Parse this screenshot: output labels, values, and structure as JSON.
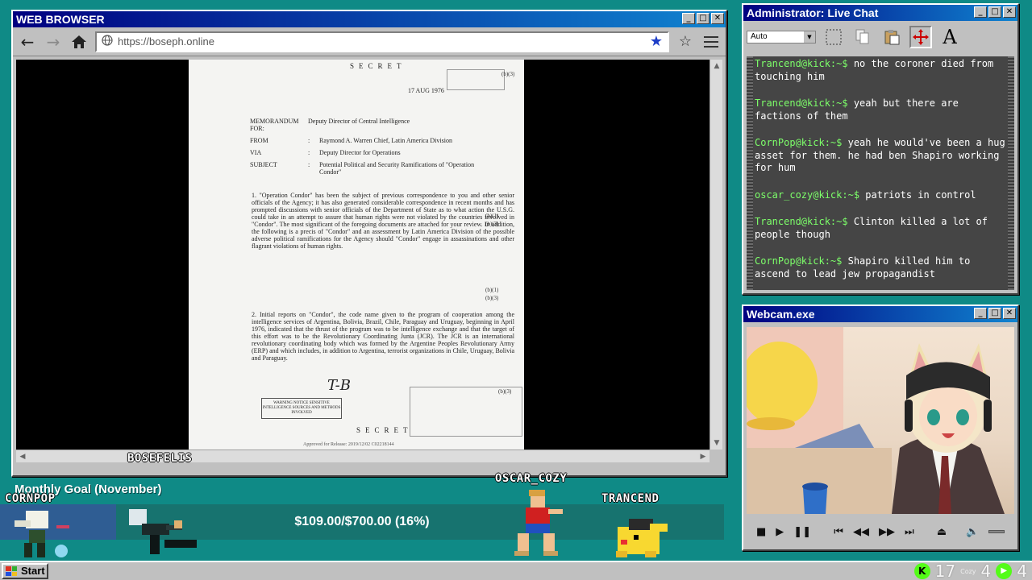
{
  "browser": {
    "title": "WEB BROWSER",
    "url": "https://boseph.online",
    "document": {
      "classification": "SECRET",
      "date": "17 AUG 1976",
      "exemption": "(b)(3)",
      "exemption_1": "(b)(1)",
      "header": [
        {
          "key": "MEMORANDUM FOR:",
          "value": "Deputy Director of Central Intelligence"
        },
        {
          "key": "FROM",
          "value": "Raymond A. Warren Chief, Latin America Division"
        },
        {
          "key": "VIA",
          "value": "Deputy Director for Operations"
        },
        {
          "key": "SUBJECT",
          "value": "Potential Political and Security Ramifications of \"Operation Condor\""
        }
      ],
      "para1": "1. \"Operation Condor\" has been the subject of previous correspondence to you and other senior officials of the Agency; it has also generated considerable correspondence in recent months and has prompted discussions with senior officials of the Department of State as to what action the U.S.G. could take in an attempt to assure that human rights were not violated by the countries involved in \"Condor\". The most significant of the foregoing documents are attached for your review. In addition, the following is a precis of \"Condor\" and an assessment by Latin America Division of the possible adverse political ramifications for the Agency should \"Condor\" engage in assassinations and other flagrant violations of human rights.",
      "para2": "2. Initial reports on \"Condor\", the code name given to the program of cooperation among the intelligence services of Argentina, Bolivia, Brazil, Chile, Paraguay and Uruguay, beginning in April 1976, indicated that the thrust of the program was to be intelligence exchange and that the target of this effort was to be the Revolutionary Coordinating Junta (JCR). The JCR is an international revolutionary coordinating body which was formed by the Argentine Peoples Revolutionary Army (ERP) and which includes, in addition to Argentina, terrorist organizations in Chile, Uruguay, Bolivia and Paraguay.",
      "signature": "T-B",
      "stamp": "WARNING NOTICE SENSITIVE INTELLIGENCE SOURCES AND METHODS INVOLVED",
      "approved": "Approved for Release: 2019/12/02 C02218144"
    }
  },
  "chat": {
    "title": "Administrator: Live Chat",
    "font_size_select": "Auto",
    "user_color": "#7dff6a",
    "messages": [
      {
        "user": "Trancend@kick:~$",
        "text": "no the coroner died from touching him"
      },
      {
        "user": "Trancend@kick:~$",
        "text": "yeah but there are factions of them"
      },
      {
        "user": "CornPop@kick:~$",
        "text": "yeah he would've been a hug asset for them. he had ben Shapiro working for hum"
      },
      {
        "user": "oscar_cozy@kick:~$",
        "text": "patriots in control"
      },
      {
        "user": "Trancend@kick:~$",
        "text": "Clinton killed a lot of people though"
      },
      {
        "user": "CornPop@kick:~$",
        "text": "Shapiro killed him to ascend to lead jew propagandist"
      }
    ]
  },
  "webcam": {
    "title": "Webcam.exe"
  },
  "goal": {
    "title": "Monthly Goal (November)",
    "text": "$109.00/$700.00 (16%)",
    "progress": 0.16
  },
  "overlay_names": {
    "bosefelis": "BOSEFELIS",
    "cornpop": "CORNPOP",
    "oscar": "OSCAR_COZY",
    "trancend": "TRANCEND"
  },
  "taskbar": {
    "start_label": "Start",
    "tray": {
      "count_a": "17",
      "count_b": "4",
      "count_c": "4",
      "cozy_label": "Cozy"
    }
  }
}
